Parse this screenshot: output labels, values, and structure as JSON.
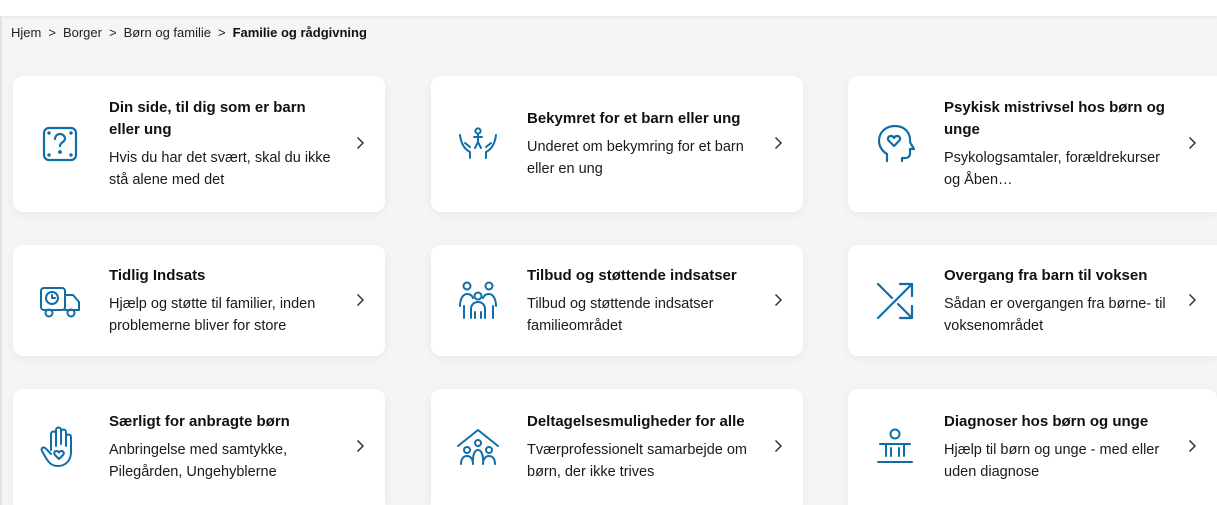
{
  "breadcrumb": {
    "items": [
      "Hjem",
      "Borger",
      "Børn og familie"
    ],
    "separator": ">",
    "current": "Familie og rådgivning"
  },
  "theme": {
    "accent": "#0f6ea8",
    "background": "#f5f5f5",
    "card": "#ffffff"
  },
  "cards": [
    {
      "title": "Din side, til dig som er barn eller ung",
      "desc": "Hvis du har det svært, skal du ikke stå alene med det",
      "icon": "question-box-icon"
    },
    {
      "title": "Bekymret for et barn eller ung",
      "desc": "Underet om bekymring for et barn eller en ung",
      "icon": "child-in-hands-icon"
    },
    {
      "title": "Psykisk mistrivsel hos børn og unge",
      "desc": "Psykologsamtaler, forældrekurser og Åben…",
      "icon": "head-heart-icon"
    },
    {
      "title": "Tidlig Indsats",
      "desc": "Hjælp og støtte til familier, inden problemerne bliver for store",
      "icon": "delivery-truck-clock-icon"
    },
    {
      "title": "Tilbud og støttende indsatser",
      "desc": "Tilbud og støttende indsatser familieområdet",
      "icon": "family-group-icon"
    },
    {
      "title": "Overgang fra barn til voksen",
      "desc": "Sådan er overgangen fra børne- til voksenområdet",
      "icon": "crossing-arrows-icon"
    },
    {
      "title": "Særligt for anbragte børn",
      "desc": "Anbringelse med samtykke, Pilegården, Ungehyblerne",
      "icon": "hand-heart-icon"
    },
    {
      "title": "Deltagelsesmuligheder for alle",
      "desc": "Tværprofessionelt samarbejde om børn, der ikke trives",
      "icon": "house-people-icon"
    },
    {
      "title": "Diagnoser hos børn og unge",
      "desc": "Hjælp til børn og unge - med eller uden diagnose",
      "icon": "person-diagnosis-icon"
    }
  ]
}
